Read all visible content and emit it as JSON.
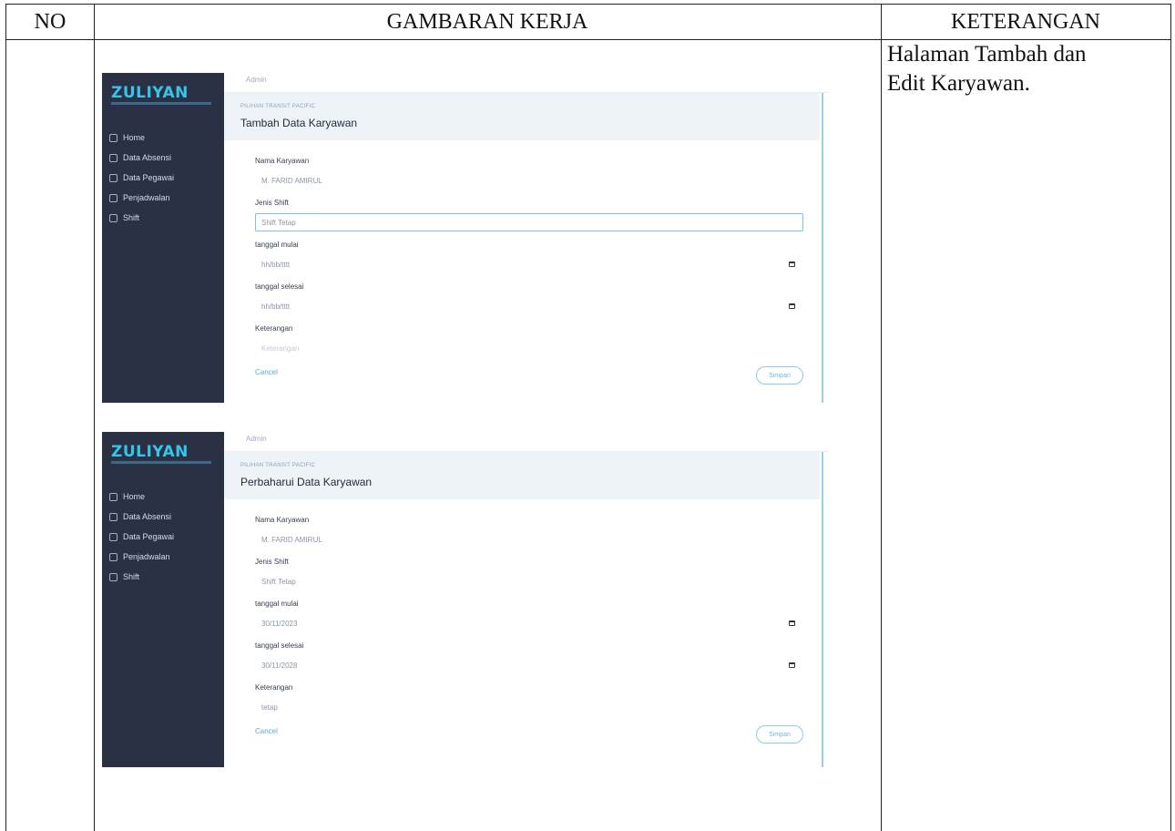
{
  "table": {
    "col_no": "NO",
    "col_gambaran": "GAMBARAN KERJA",
    "col_keterangan": "KETERANGAN",
    "keterangan_line1": "Halaman Tambah dan",
    "keterangan_line2": "Edit Karyawan."
  },
  "app": {
    "logo": "ZULIYAN",
    "sidebar": {
      "items": [
        {
          "label": "Home",
          "icon": "home-icon"
        },
        {
          "label": "Data Absensi",
          "icon": "list-icon"
        },
        {
          "label": "Data Pegawai",
          "icon": "user-icon"
        },
        {
          "label": "Penjadwalan",
          "icon": "calendar-icon"
        },
        {
          "label": "Shift",
          "icon": "clock-icon"
        }
      ]
    },
    "topbar_text": "Admin",
    "breadcrumb": "PILIHAN TRANSIT PACIFIC"
  },
  "screen_add": {
    "title": "Tambah Data Karyawan",
    "fields": {
      "nama_label": "Nama Karyawan",
      "nama_value": "M. FARID AMIRUL",
      "shift_label": "Jenis Shift",
      "shift_value": "Shift Tetap",
      "mulai_label": "tanggal mulai",
      "mulai_value": "hh/bb/tttt",
      "selesai_label": "tanggal selesai",
      "selesai_value": "hh/bb/tttt",
      "ket_label": "Keterangan",
      "ket_value": "Keterangan"
    },
    "cancel": "Cancel",
    "save": "Simpan"
  },
  "screen_edit": {
    "title": "Perbaharui Data Karyawan",
    "fields": {
      "nama_label": "Nama Karyawan",
      "nama_value": "M. FARID AMIRUL",
      "shift_label": "Jenis Shift",
      "shift_value": "Shift Tetap",
      "mulai_label": "tanggal mulai",
      "mulai_value": "30/11/2023",
      "selesai_label": "tanggal selesai",
      "selesai_value": "30/11/2028",
      "ket_label": "Keterangan",
      "ket_value": "tetap"
    },
    "cancel": "Cancel",
    "save": "Simpan"
  }
}
